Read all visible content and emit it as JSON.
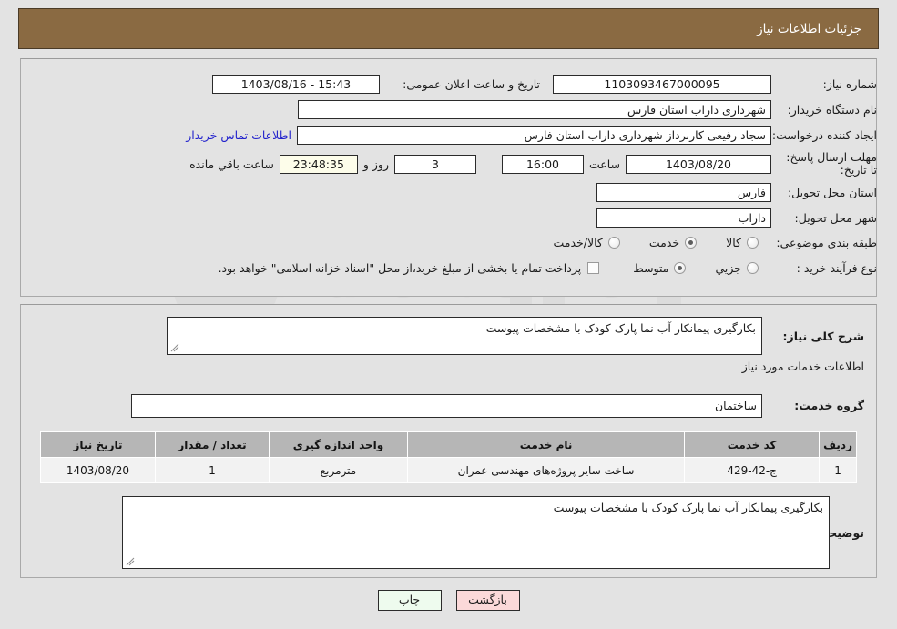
{
  "header": {
    "title": "جزئیات اطلاعات نیاز"
  },
  "watermark": {
    "text": "AriaTender.net"
  },
  "form": {
    "need_number_label": "شماره نیاز:",
    "need_number_value": "1103093467000095",
    "announce_datetime_label": "تاریخ و ساعت اعلان عمومی:",
    "announce_datetime_value": "15:43 - 1403/08/16",
    "buyer_org_label": "نام دستگاه خریدار:",
    "buyer_org_value": "شهرداری داراب استان فارس",
    "creator_label": "ایجاد کننده درخواست:",
    "creator_value": "سجاد رفیعی کاربرداز  شهرداری داراب استان فارس",
    "contact_link": "اطلاعات تماس خریدار",
    "deadline_label": "مهلت ارسال پاسخ: تا تاریخ:",
    "deadline_date": "1403/08/20",
    "hour_label": "ساعت",
    "deadline_time": "16:00",
    "days_left": "3",
    "days_label": "روز و",
    "countdown": "23:48:35",
    "countdown_label": "ساعت باقي مانده",
    "province_label": "استان محل تحویل:",
    "province_value": "فارس",
    "city_label": "شهر محل تحویل:",
    "city_value": "داراب",
    "category_label": "طبقه بندی موضوعی:",
    "category_options": [
      {
        "label": "کالا",
        "selected": false
      },
      {
        "label": "خدمت",
        "selected": true
      },
      {
        "label": "کالا/خدمت",
        "selected": false
      }
    ],
    "process_label": "نوع فرآیند خرید :",
    "process_options": [
      {
        "label": "جزیي",
        "selected": false
      },
      {
        "label": "متوسط",
        "selected": true
      }
    ],
    "treasury_checkbox_checked": false,
    "treasury_note": "پرداخت تمام یا بخشی از مبلغ خرید،از محل \"اسناد خزانه اسلامی\" خواهد بود."
  },
  "description": {
    "general_label": "شرح کلی نیاز:",
    "general_value": "بکارگیری پیمانکار آب نما پارک کودک با مشخصات پیوست",
    "services_section_title": "اطلاعات خدمات مورد نیاز",
    "service_group_label": "گروه خدمت:",
    "service_group_value": "ساختمان",
    "buyer_notes_label": "توضیحات خریدار:",
    "buyer_notes_value": "بکارگیری پیمانکار آب نما پارک کودک با مشخصات پیوست"
  },
  "table": {
    "columns": [
      "ردیف",
      "کد خدمت",
      "نام خدمت",
      "واحد اندازه گیری",
      "تعداد / مقدار",
      "تاریخ نیاز"
    ],
    "rows": [
      {
        "row_no": "1",
        "service_code": "ج-42-429",
        "service_name": "ساخت سایر پروژه‌های مهندسی عمران",
        "unit": "مترمربع",
        "quantity": "1",
        "need_date": "1403/08/20"
      }
    ]
  },
  "buttons": {
    "print": "چاپ",
    "return": "بازگشت"
  },
  "colors": {
    "header_bg": "#8a6a42",
    "page_bg": "#e3e3e3",
    "link": "#2222cc",
    "print_btn": "#eefbee",
    "return_btn": "#fbd9d9",
    "countdown_bg": "#fdfdea",
    "table_header": "#b6b6b6"
  }
}
